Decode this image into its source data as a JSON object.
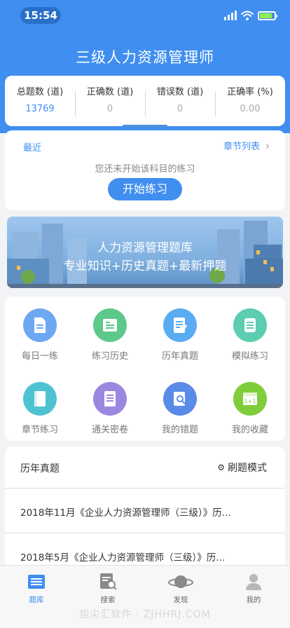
{
  "status": {
    "time": "15:54"
  },
  "header": {
    "title": "三级人力资源管理师"
  },
  "stats": [
    {
      "label": "总题数 (道)",
      "value": "13769"
    },
    {
      "label": "正确数 (道)",
      "value": "0"
    },
    {
      "label": "错误数 (道)",
      "value": "0"
    },
    {
      "label": "正确率 (%)",
      "value": "0.00"
    }
  ],
  "practice": {
    "recent_label": "最近",
    "chapter_list_label": "章节列表",
    "not_started_text": "您还未开始该科目的练习",
    "start_button": "开始练习"
  },
  "banner": {
    "line1": "人力资源管理题库",
    "line2": "专业知识+历史真题+最新押题"
  },
  "menu": [
    {
      "label": "每日一练",
      "icon": "document-icon",
      "color": "#6fa8f2"
    },
    {
      "label": "练习历史",
      "icon": "history-icon",
      "color": "#5cc98a"
    },
    {
      "label": "历年真题",
      "icon": "exam-icon",
      "color": "#5aacf2"
    },
    {
      "label": "模拟练习",
      "icon": "scroll-icon",
      "color": "#5ccdb0"
    },
    {
      "label": "章节练习",
      "icon": "book-icon",
      "color": "#4fc2d2"
    },
    {
      "label": "通关密卷",
      "icon": "paper-icon",
      "color": "#9b87e0"
    },
    {
      "label": "我的错题",
      "icon": "search-doc-icon",
      "color": "#5b8be8"
    },
    {
      "label": "我的收藏",
      "icon": "calendar-icon",
      "color": "#7fcd3a"
    }
  ],
  "past_exams": {
    "title": "历年真题",
    "mode_label": "刷题模式",
    "items": [
      "2018年11月《企业人力资源管理师（三级）》历...",
      "2018年5月《企业人力资源管理师（三级）》历..."
    ]
  },
  "tabs": [
    {
      "label": "题库",
      "icon": "question-bank-icon"
    },
    {
      "label": "搜索",
      "icon": "search-icon"
    },
    {
      "label": "发现",
      "icon": "planet-icon"
    },
    {
      "label": "我的",
      "icon": "user-icon"
    }
  ],
  "watermark": "指尖汇软件 · ZJHHRJ.COM",
  "colors": {
    "primary": "#3f8ef0"
  }
}
